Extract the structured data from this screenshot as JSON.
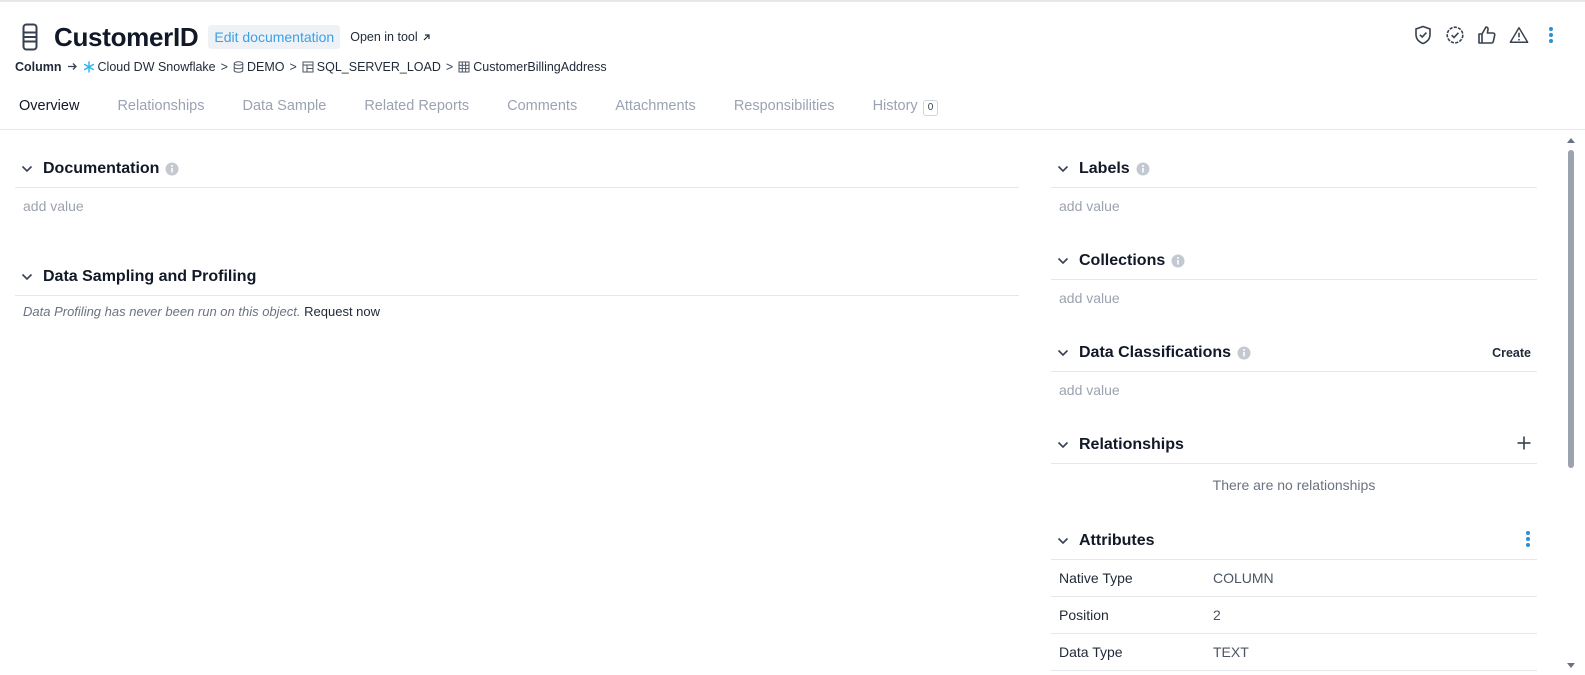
{
  "header": {
    "title": "CustomerID",
    "edit_doc_label": "Edit documentation",
    "open_tool_label": "Open in tool",
    "open_tool_icon": "external-link-icon",
    "actions": [
      "shield-check-icon",
      "badge-check-icon",
      "thumbs-up-icon",
      "warning-icon",
      "more-vertical-icon"
    ]
  },
  "breadcrumb": {
    "type_label": "Column",
    "items": [
      {
        "label": "Cloud DW Snowflake",
        "icon": "snowflake-icon"
      },
      {
        "label": "DEMO",
        "icon": "database-icon"
      },
      {
        "label": "SQL_SERVER_LOAD",
        "icon": "schema-icon"
      },
      {
        "label": "CustomerBillingAddress",
        "icon": "table-icon"
      }
    ]
  },
  "tabs": [
    {
      "label": "Overview",
      "active": true
    },
    {
      "label": "Relationships"
    },
    {
      "label": "Data Sample"
    },
    {
      "label": "Related Reports"
    },
    {
      "label": "Comments"
    },
    {
      "label": "Attachments"
    },
    {
      "label": "Responsibilities"
    },
    {
      "label": "History",
      "count": "0"
    }
  ],
  "left": {
    "documentation": {
      "title": "Documentation",
      "placeholder": "add value"
    },
    "profiling": {
      "title": "Data Sampling and Profiling",
      "message": "Data Profiling has never been run on this object.",
      "request_label": "Request now"
    }
  },
  "right": {
    "labels": {
      "title": "Labels",
      "placeholder": "add value"
    },
    "collections": {
      "title": "Collections",
      "placeholder": "add value"
    },
    "classifications": {
      "title": "Data Classifications",
      "placeholder": "add value",
      "create_label": "Create"
    },
    "relationships": {
      "title": "Relationships",
      "empty": "There are no relationships"
    },
    "attributes": {
      "title": "Attributes",
      "rows": [
        {
          "key": "Native Type",
          "value": "COLUMN"
        },
        {
          "key": "Position",
          "value": "2"
        },
        {
          "key": "Data Type",
          "value": "TEXT"
        }
      ]
    }
  },
  "colors": {
    "accent": "#3ba0e6",
    "menu_dots": "#2b8fd6",
    "snowflake": "#29b5e8"
  }
}
